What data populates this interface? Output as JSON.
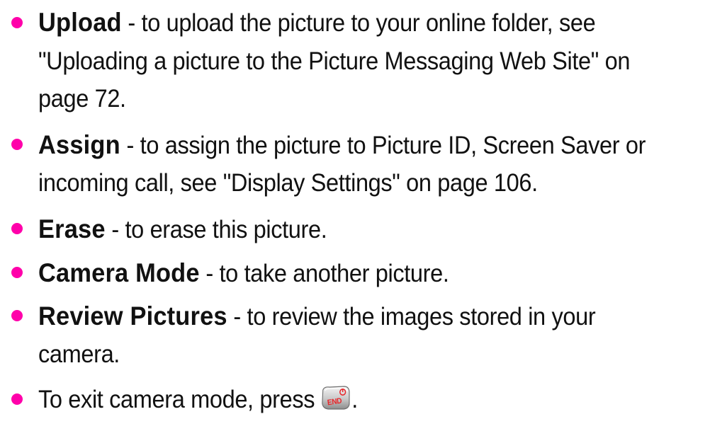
{
  "items": [
    {
      "term": "Upload",
      "rest": " - to upload the picture to your online folder, see",
      "continuation": [
        "\"Uploading a picture to the Picture Messaging Web Site\" on",
        "page 72."
      ]
    },
    {
      "term": "Assign",
      "rest": " - to assign the picture to Picture ID, Screen Saver or",
      "continuation": [
        "incoming call, see \"Display Settings\" on page 106."
      ]
    },
    {
      "term": "Erase",
      "rest": " - to erase this picture.",
      "continuation": []
    },
    {
      "term": "Camera Mode",
      "rest": " - to take another picture.",
      "continuation": []
    },
    {
      "term": "Review Pictures",
      "rest": " - to review the images stored in your",
      "continuation": [
        "camera."
      ]
    }
  ],
  "exit": {
    "text": "To exit camera mode, press",
    "key_icon": "end-key-icon",
    "key_label": "END",
    "period": "."
  },
  "colors": {
    "bullet": "#ff00aa",
    "text": "#111111",
    "key_red": "#e8262a"
  }
}
